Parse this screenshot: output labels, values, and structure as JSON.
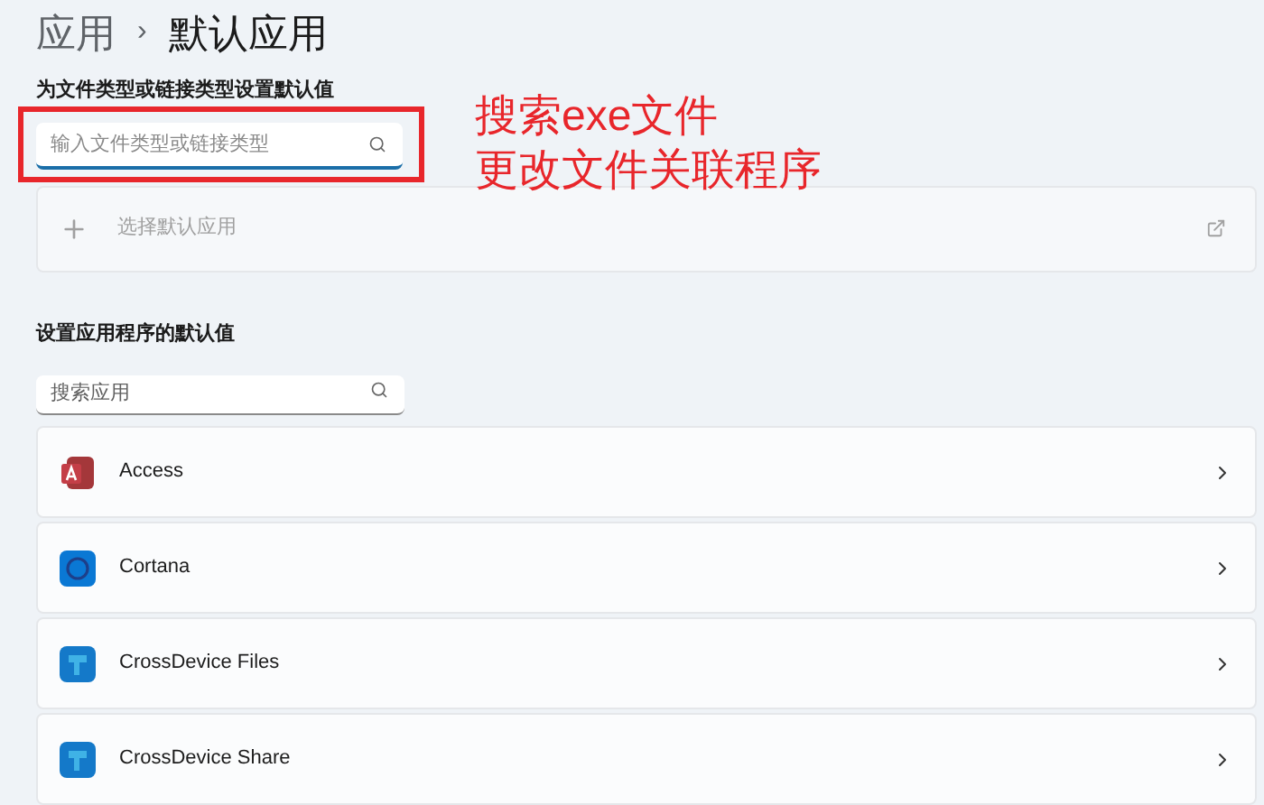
{
  "breadcrumb": {
    "parent": "应用",
    "separator": "›",
    "current": "默认应用"
  },
  "file_types": {
    "label": "为文件类型或链接类型设置默认值",
    "search": {
      "placeholder": "输入文件类型或链接类型"
    },
    "choose_default": {
      "label": "选择默认应用",
      "disabled": true
    }
  },
  "apps_section": {
    "label": "设置应用程序的默认值",
    "search": {
      "placeholder": "搜索应用"
    },
    "apps": [
      {
        "name": "Access",
        "kind": "access"
      },
      {
        "name": "Cortana",
        "kind": "cortana"
      },
      {
        "name": "CrossDevice Files",
        "kind": "crossdevice"
      },
      {
        "name": "CrossDevice Share",
        "kind": "crossdevice"
      }
    ]
  },
  "annotation": {
    "lines": [
      "搜索exe文件",
      "更改文件关联程序"
    ]
  }
}
